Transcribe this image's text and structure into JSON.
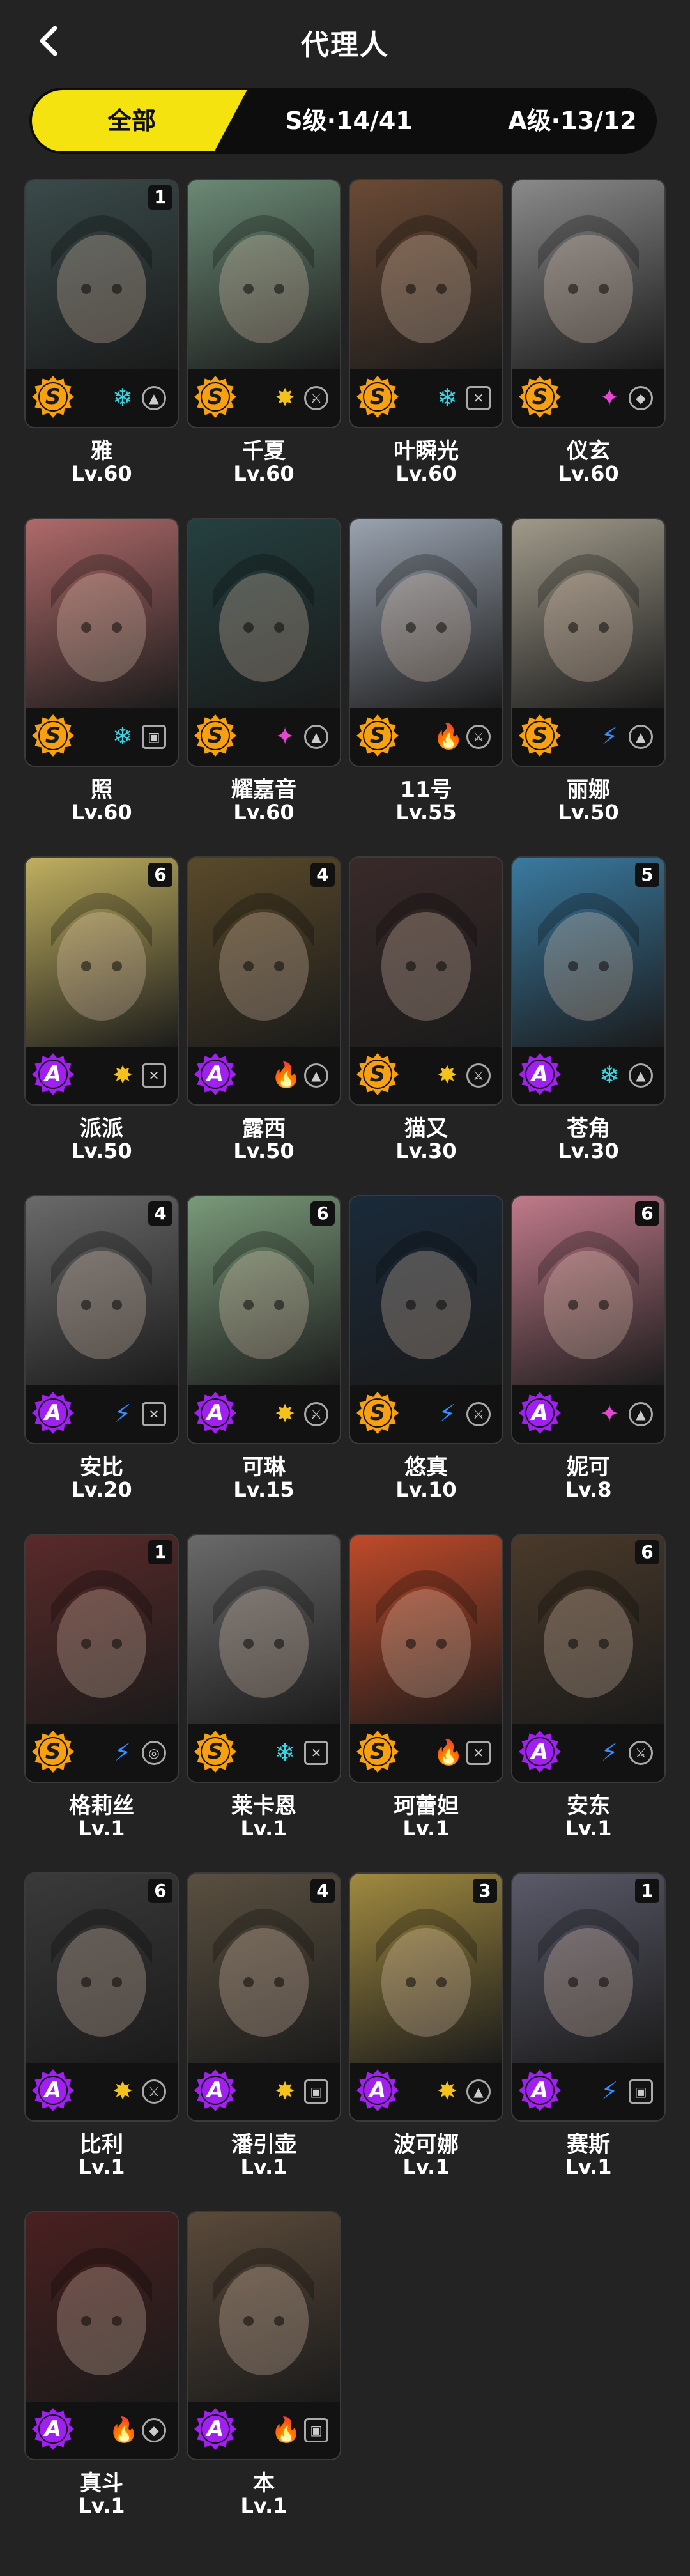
{
  "header": {
    "title": "代理人"
  },
  "tabs": [
    {
      "label": "全部",
      "active": true
    },
    {
      "label": "S级·14/41",
      "active": false
    },
    {
      "label": "A级·13/12",
      "active": false
    }
  ],
  "colors": {
    "accent": "#f5e310",
    "rank_s": "#f7a012",
    "rank_a": "#a020f0",
    "background": "#232323"
  },
  "agents": [
    {
      "name": "雅",
      "level": "Lv.60",
      "rank": "S",
      "badge": "1",
      "element": "ice-icon",
      "role": "support-icon",
      "art": "#3a4a4a"
    },
    {
      "name": "千夏",
      "level": "Lv.60",
      "rank": "S",
      "badge": "",
      "element": "physical-icon",
      "role": "attack-icon",
      "art": "#6b8a75"
    },
    {
      "name": "叶瞬光",
      "level": "Lv.60",
      "rank": "S",
      "badge": "",
      "element": "ice-icon",
      "role": "stun-icon",
      "art": "#6a4a35"
    },
    {
      "name": "仪玄",
      "level": "Lv.60",
      "rank": "S",
      "badge": "",
      "element": "ether-icon",
      "role": "rupture-icon",
      "art": "#8a8a8a"
    },
    {
      "name": "照",
      "level": "Lv.60",
      "rank": "S",
      "badge": "",
      "element": "ice-icon",
      "role": "defense-icon",
      "art": "#b06a6a"
    },
    {
      "name": "耀嘉音",
      "level": "Lv.60",
      "rank": "S",
      "badge": "",
      "element": "ether-icon",
      "role": "support-icon",
      "art": "#254040"
    },
    {
      "name": "11号",
      "level": "Lv.55",
      "rank": "S",
      "badge": "",
      "element": "fire-icon",
      "role": "attack-icon",
      "art": "#9aa3b0"
    },
    {
      "name": "丽娜",
      "level": "Lv.50",
      "rank": "S",
      "badge": "",
      "element": "electric-icon",
      "role": "support-icon",
      "art": "#a09a8a"
    },
    {
      "name": "派派",
      "level": "Lv.50",
      "rank": "A",
      "badge": "6",
      "element": "physical-icon",
      "role": "stun-icon",
      "art": "#c0b060"
    },
    {
      "name": "露西",
      "level": "Lv.50",
      "rank": "A",
      "badge": "4",
      "element": "fire-icon",
      "role": "support-icon",
      "art": "#5a4a2a"
    },
    {
      "name": "猫又",
      "level": "Lv.30",
      "rank": "S",
      "badge": "",
      "element": "physical-icon",
      "role": "attack-icon",
      "art": "#3a2a2a"
    },
    {
      "name": "苍角",
      "level": "Lv.30",
      "rank": "A",
      "badge": "5",
      "element": "ice-icon",
      "role": "support-icon",
      "art": "#3a7aa0"
    },
    {
      "name": "安比",
      "level": "Lv.20",
      "rank": "A",
      "badge": "4",
      "element": "electric-icon",
      "role": "stun-icon",
      "art": "#6a6a6a"
    },
    {
      "name": "可琳",
      "level": "Lv.15",
      "rank": "A",
      "badge": "6",
      "element": "physical-icon",
      "role": "attack-icon",
      "art": "#7a9a7a"
    },
    {
      "name": "悠真",
      "level": "Lv.10",
      "rank": "S",
      "badge": "",
      "element": "electric-icon",
      "role": "attack-icon",
      "art": "#1a2a3a"
    },
    {
      "name": "妮可",
      "level": "Lv.8",
      "rank": "A",
      "badge": "6",
      "element": "ether-icon",
      "role": "support-icon",
      "art": "#c07a8a"
    },
    {
      "name": "格莉丝",
      "level": "Lv.1",
      "rank": "S",
      "badge": "1",
      "element": "electric-icon",
      "role": "anomaly-icon",
      "art": "#5a2a2a"
    },
    {
      "name": "莱卡恩",
      "level": "Lv.1",
      "rank": "S",
      "badge": "",
      "element": "ice-icon",
      "role": "stun-icon",
      "art": "#6a6a6a"
    },
    {
      "name": "珂蕾妲",
      "level": "Lv.1",
      "rank": "S",
      "badge": "",
      "element": "fire-icon",
      "role": "stun-icon",
      "art": "#c04a2a"
    },
    {
      "name": "安东",
      "level": "Lv.1",
      "rank": "A",
      "badge": "6",
      "element": "electric-icon",
      "role": "attack-icon",
      "art": "#4a3a2a"
    },
    {
      "name": "比利",
      "level": "Lv.1",
      "rank": "A",
      "badge": "6",
      "element": "physical-icon",
      "role": "attack-icon",
      "art": "#3a3a3a"
    },
    {
      "name": "潘引壶",
      "level": "Lv.1",
      "rank": "A",
      "badge": "4",
      "element": "physical-icon",
      "role": "defense-icon",
      "art": "#5a5040"
    },
    {
      "name": "波可娜",
      "level": "Lv.1",
      "rank": "A",
      "badge": "3",
      "element": "physical-icon",
      "role": "support-icon",
      "art": "#a08a40"
    },
    {
      "name": "赛斯",
      "level": "Lv.1",
      "rank": "A",
      "badge": "1",
      "element": "electric-icon",
      "role": "defense-icon",
      "art": "#5a5a6a"
    },
    {
      "name": "真斗",
      "level": "Lv.1",
      "rank": "A",
      "badge": "",
      "element": "fire-icon",
      "role": "rupture-icon",
      "art": "#4a2020"
    },
    {
      "name": "本",
      "level": "Lv.1",
      "rank": "A",
      "badge": "",
      "element": "fire-icon",
      "role": "defense-icon",
      "art": "#5a4a3a"
    }
  ]
}
